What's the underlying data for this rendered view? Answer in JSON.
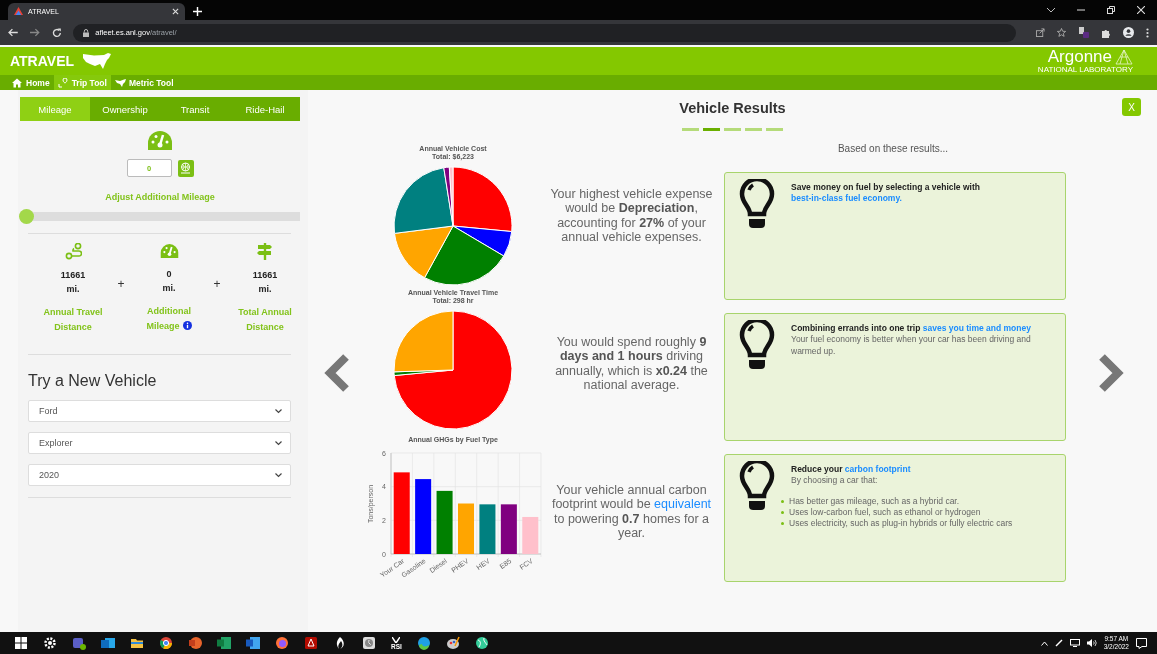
{
  "browser": {
    "tab_title": "ATRAVEL",
    "address_host": "afleet.es.anl.gov",
    "address_path": "/atravel/"
  },
  "header": {
    "title": "ATRAVEL",
    "logo_text": "Argonne",
    "logo_subtext": "NATIONAL LABORATORY",
    "nav": [
      {
        "label": "Home",
        "kind": "home",
        "selected": false
      },
      {
        "label": "Trip Tool",
        "kind": "trip",
        "selected": true
      },
      {
        "label": "Metric Tool",
        "kind": "map",
        "selected": false
      }
    ]
  },
  "mileage_tabs": [
    {
      "label": "Mileage",
      "selected": true
    },
    {
      "label": "Ownership",
      "selected": false
    },
    {
      "label": "Transit",
      "selected": false
    },
    {
      "label": "Ride-Hail",
      "selected": false
    }
  ],
  "mileage": {
    "input_value": "0",
    "slider_label": "Adjust Additional Mileage",
    "level": 0,
    "stats": [
      {
        "kind": "route",
        "value": "11661",
        "unit": "mi.",
        "label": "Annual Travel Distance",
        "info": false
      },
      {
        "kind": "gauge",
        "value": "0",
        "unit": "mi.",
        "label": "Additional Mileage",
        "info": true
      },
      {
        "kind": "sign",
        "value": "11661",
        "unit": "mi.",
        "label": "Total Annual Distance",
        "info": false
      }
    ],
    "operators": [
      "+",
      "+"
    ]
  },
  "new_vehicle": {
    "heading": "Try a New Vehicle",
    "selects": [
      "Ford",
      "Explorer",
      "2020"
    ]
  },
  "results": {
    "title": "Vehicle Results",
    "close_label": "X",
    "pages": [
      {
        "selected": false
      },
      {
        "selected": true
      },
      {
        "selected": false
      },
      {
        "selected": false
      },
      {
        "selected": false
      }
    ],
    "advice_heading": "Based on these results...",
    "charts": [
      {
        "kind": "pie",
        "title": "Annual Vehicle Cost",
        "subtitle": "Total: $6,223"
      },
      {
        "kind": "pie",
        "title": "Annual Vehicle Travel Time",
        "subtitle": "Total: 298 hr"
      },
      {
        "kind": "bar",
        "chart_data": {
          "type": "bar",
          "title": "Annual GHGs by Fuel Type",
          "ylabel": "Tons/person",
          "series": [
            {
              "name": "Your Car",
              "color": "#ff0000",
              "values": [
                4.85,
                null,
                null,
                null,
                null,
                null,
                null
              ]
            },
            {
              "name": "Gasoline",
              "color": "#0000ff",
              "values": [
                null,
                4.45,
                null,
                null,
                null,
                null,
                null
              ]
            },
            {
              "name": "Diesel",
              "color": "#008000",
              "values": [
                null,
                null,
                3.75,
                null,
                null,
                null,
                null
              ]
            },
            {
              "name": "PHEV",
              "color": "#ffa500",
              "values": [
                null,
                null,
                null,
                3.0,
                null,
                null,
                null
              ]
            },
            {
              "name": "HEV",
              "color": "#008080",
              "values": [
                null,
                null,
                null,
                null,
                2.95,
                null,
                null
              ]
            },
            {
              "name": "E85",
              "color": "#800080",
              "values": [
                null,
                null,
                null,
                null,
                null,
                2.95,
                null
              ]
            },
            {
              "name": "FCV",
              "color": "#ffc0cb",
              "values": [
                null,
                null,
                null,
                null,
                null,
                null,
                2.2
              ]
            }
          ],
          "ylim": [
            0,
            6
          ],
          "yticks": [
            0,
            2,
            4,
            6
          ]
        }
      }
    ],
    "summaries": [
      {
        "text": "Your highest vehicle expense would be **Depreciation**, accounting for **27%** of your annual vehicle expenses."
      },
      {
        "text": "You would spend roughly **9 days and 1 hours** driving annually, which is **x0.24** the national average."
      },
      {
        "text": "Your vehicle annual carbon footprint would be ",
        "link": "equivalent",
        "after": " to powering **0.7** homes for a year."
      }
    ],
    "tips": [
      {
        "headline": "Save money on fuel by selecting a vehicle with ",
        "link": "best-in-class fuel economy."
      },
      {
        "headline": "Combining errands into one trip ",
        "link": "saves you time and money",
        "body": "Your fuel economy is better when your car has been driving and warmed up."
      },
      {
        "headline": "Reduce your ",
        "link": "carbon footprint",
        "body": "By choosing a car that:",
        "bullets": [
          "Has better gas mileage, such as a hybrid car.",
          "Uses low-carbon fuel, such as ethanol or hydrogen",
          "Uses electricity, such as plug-in hybrids or fully electric cars"
        ]
      }
    ]
  },
  "taskbar": {
    "rsi_label": "RSI",
    "time": "9:57 AM",
    "date": "3/2/2022"
  }
}
